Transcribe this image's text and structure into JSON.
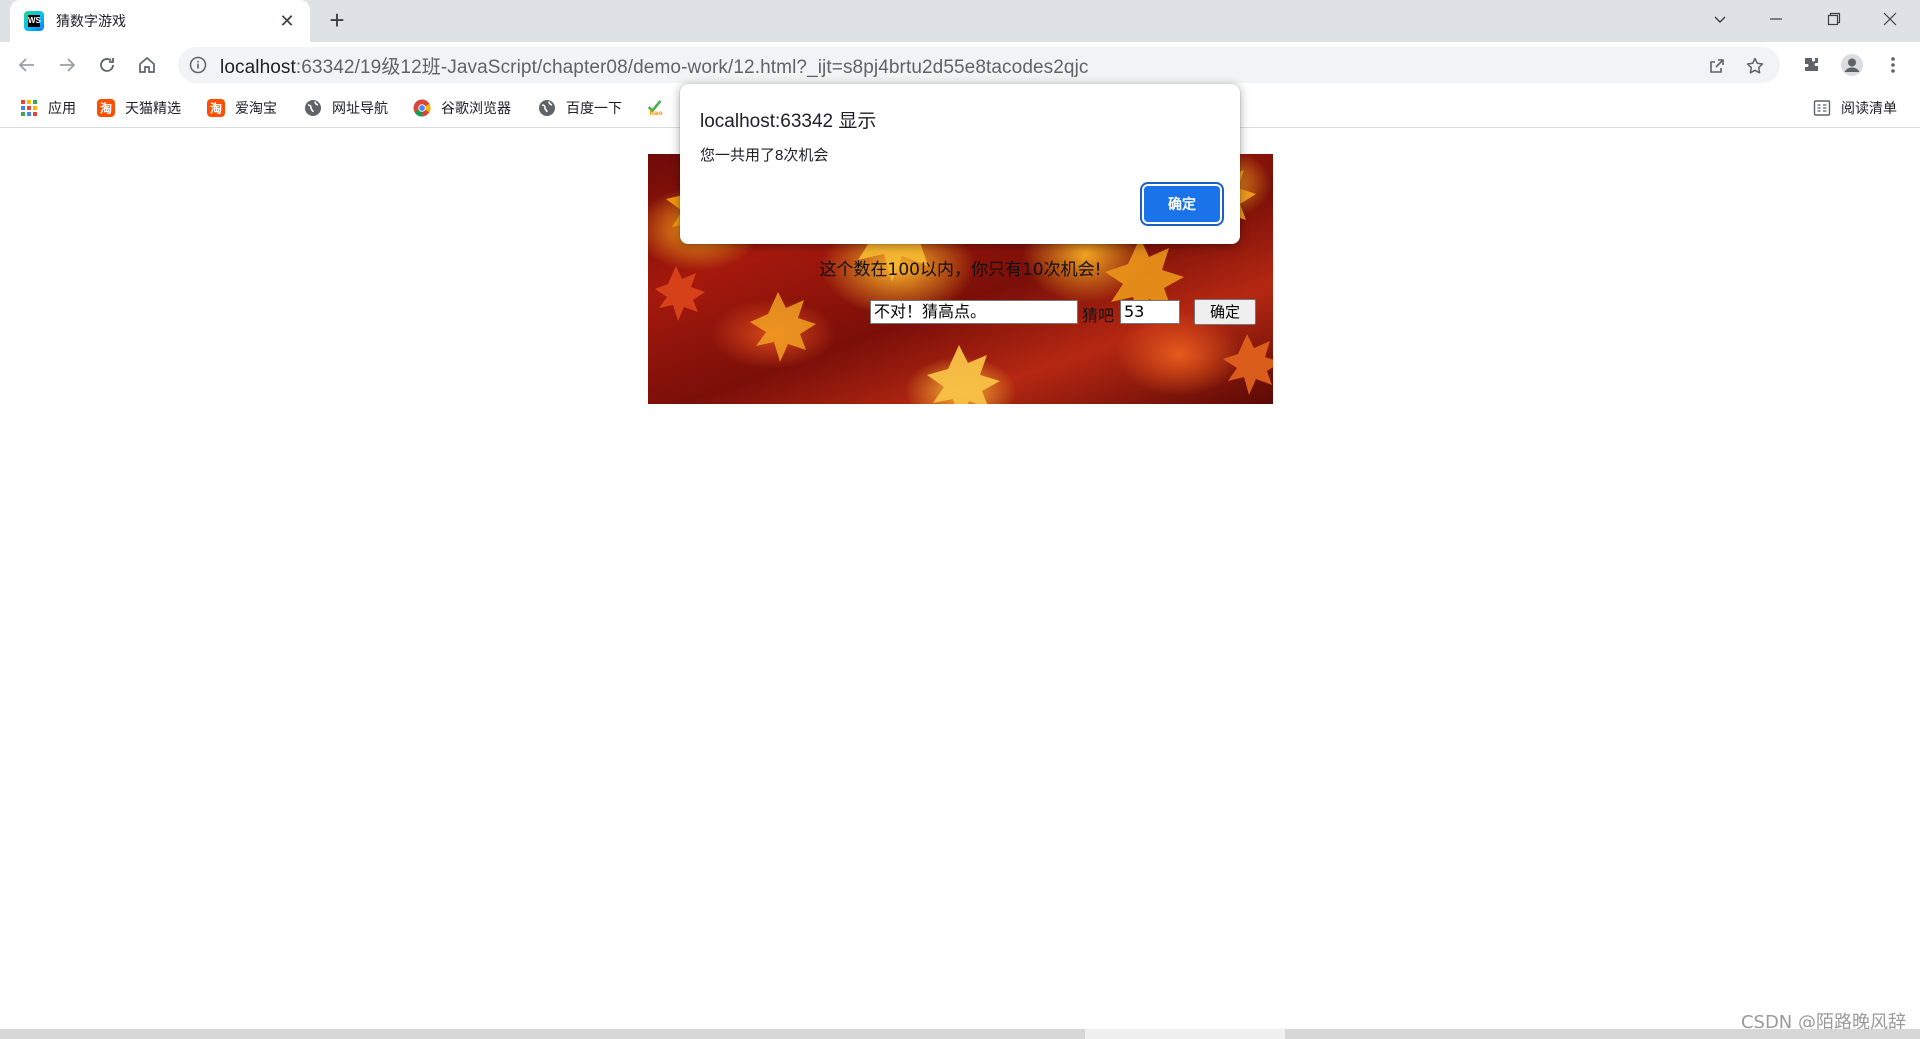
{
  "browser": {
    "tab": {
      "title": "猜数字游戏"
    },
    "url": {
      "host": "localhost",
      "path": ":63342/19级12班-JavaScript/chapter08/demo-work/12.html?_ijt=s8pj4brtu2d55e8tacodes2qjc"
    },
    "bookmarks": [
      {
        "label": "应用",
        "icon": "apps-grid-icon"
      },
      {
        "label": "天猫精选",
        "icon": "taobao-icon"
      },
      {
        "label": "爱淘宝",
        "icon": "taobao-icon"
      },
      {
        "label": "网址导航",
        "icon": "globe-icon"
      },
      {
        "label": "谷歌浏览器",
        "icon": "chrome-icon"
      },
      {
        "label": "百度一下",
        "icon": "globe-icon"
      },
      {
        "label": "",
        "icon": "hao-icon"
      }
    ],
    "reading_list": "阅读清单",
    "colors": {
      "tabstrip": "#dee1e6",
      "accent": "#1a73e8"
    }
  },
  "page": {
    "hint": "这个数在100以内，你只有10次机会!",
    "feedback_value": "不对！猜高点。",
    "guess_label": "猜吧",
    "guess_value": "53",
    "submit_label": "确定"
  },
  "dialog": {
    "title": "localhost:63342 显示",
    "message": "您一共用了8次机会",
    "ok_label": "确定"
  },
  "watermark": "CSDN @陌路晚风辞"
}
